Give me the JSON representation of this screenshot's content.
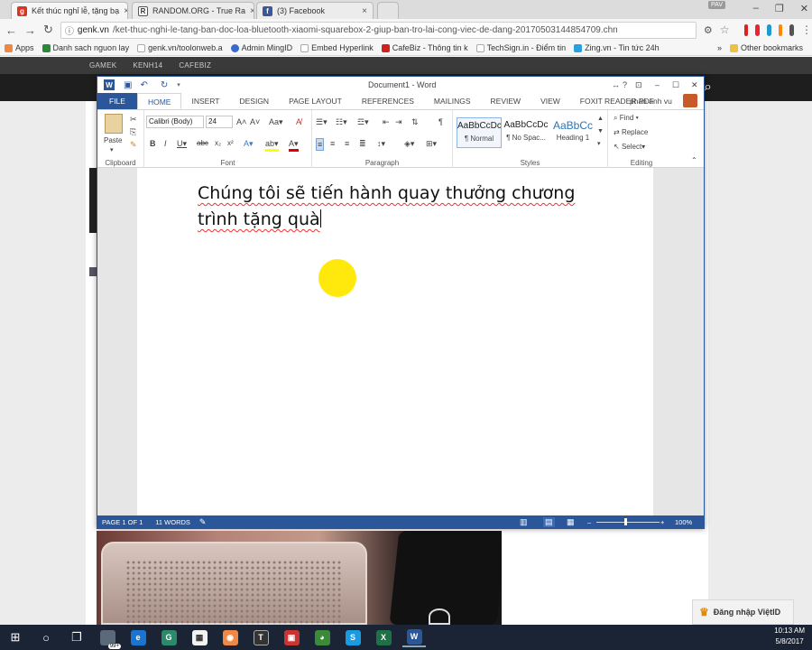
{
  "browser": {
    "tabs": [
      {
        "label": "Kết thúc nghỉ lễ, tặng bạ",
        "favicon": "genk"
      },
      {
        "label": "RANDOM.ORG - True Ra",
        "favicon": "random"
      },
      {
        "label": "(3) Facebook",
        "favicon": "facebook"
      }
    ],
    "profile": "PAV",
    "url_host": "genk.vn",
    "url_path": "/ket-thuc-nghi-le-tang-ban-doc-loa-bluetooth-xiaomi-squarebox-2-giup-ban-tro-lai-cong-viec-de-dang-20170503144854709.chn",
    "bookmarks": [
      {
        "label": "Apps",
        "color": "#e84"
      },
      {
        "label": "Danh sach nguon lay",
        "color": "#2a8a3a"
      },
      {
        "label": "genk.vn/toolonweb.a",
        "color": "#fff"
      },
      {
        "label": "Admin MingID",
        "color": "#3a6ad0"
      },
      {
        "label": "Embed Hyperlink",
        "color": "#fff"
      },
      {
        "label": "CafeBiz - Thông tin k",
        "color": "#d02020"
      },
      {
        "label": "TechSign.in - Điểm tin",
        "color": "#fff"
      },
      {
        "label": "Zing.vn - Tin tức 24h",
        "color": "#2aa0e0"
      }
    ],
    "bookmarks_overflow": "»",
    "other_bookmarks": "Other bookmarks"
  },
  "site": {
    "nav": [
      "GAMEK",
      "KENH14",
      "CAFEBIZ"
    ]
  },
  "word": {
    "title": "Document1 - Word",
    "user": "phan anh vu",
    "help": "?",
    "tabs": [
      "FILE",
      "HOME",
      "INSERT",
      "DESIGN",
      "PAGE LAYOUT",
      "REFERENCES",
      "MAILINGS",
      "REVIEW",
      "VIEW",
      "FOXIT READER PDF"
    ],
    "font_name": "Calibri (Body)",
    "font_size": "24",
    "paste_label": "Paste",
    "groups": {
      "clipboard": "Clipboard",
      "font": "Font",
      "paragraph": "Paragraph",
      "styles": "Styles",
      "editing": "Editing"
    },
    "styles": [
      {
        "preview": "AaBbCcDc",
        "name": "¶ Normal"
      },
      {
        "preview": "AaBbCcDc",
        "name": "¶ No Spac..."
      },
      {
        "preview": "AaBbCc",
        "name": "Heading 1"
      }
    ],
    "editing": {
      "find": "Find",
      "replace": "Replace",
      "select": "Select"
    },
    "doc_line1": "Chúng tôi sẽ tiến hành quay thưởng chương",
    "doc_line2": "trình tặng quà",
    "status": {
      "page": "PAGE 1 OF 1",
      "words": "11 WORDS",
      "zoom": "100%"
    }
  },
  "overlay": {
    "login_label": "Đăng nhập ViệtID"
  },
  "taskbar": {
    "time": "10:13 AM",
    "date": "5/8/2017",
    "badge": "99+"
  }
}
